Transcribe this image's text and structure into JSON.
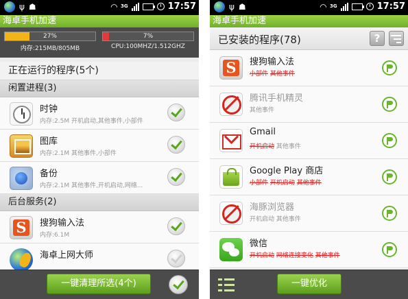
{
  "left": {
    "status_time": "17:57",
    "network_label": "3G",
    "app_title": "海卓手机加速",
    "memory": {
      "percent": 27,
      "percent_label": "27%",
      "label": "内存:215MB/805MB",
      "bar_color": "#f3b418"
    },
    "cpu": {
      "percent": 7,
      "percent_label": "7%",
      "label": "CPU:100MHZ/1.512GHZ",
      "bar_color": "#e03a3a"
    },
    "running_title": "正在运行的程序(5个)",
    "sections": [
      {
        "title": "闲置进程(3)",
        "items": [
          {
            "name": "时钟",
            "detail": "内存:2.5M 开机启动,其他事件,小部件",
            "icon": "clock-icon",
            "checked": true
          },
          {
            "name": "图库",
            "detail": "内存:2.1M 其他事件,小部件",
            "icon": "gallery-icon",
            "checked": true
          },
          {
            "name": "备份",
            "detail": "内存:2.1M 其他事件,开机启动,网络...",
            "icon": "backup-icon",
            "checked": true
          }
        ]
      },
      {
        "title": "后台服务(2)",
        "items": [
          {
            "name": "搜狗输入法",
            "detail": "内存:6.1M",
            "icon": "sogou-icon",
            "checked": true
          },
          {
            "name": "海卓上网大师",
            "detail": "",
            "icon": "globe-icon",
            "checked": false
          }
        ]
      }
    ],
    "clean_button": "一键清理所选(4个)"
  },
  "right": {
    "status_time": "17:57",
    "network_label": "3G",
    "app_title": "海卓手机加速",
    "installed_title": "已安装的程序(78)",
    "help_label": "?",
    "apps": [
      {
        "name": "搜狗输入法",
        "icon": "sogou-icon",
        "disabled": false,
        "tags": [
          {
            "text": "小部件",
            "style": "red"
          },
          {
            "text": "其他事件",
            "style": "red"
          }
        ]
      },
      {
        "name": "腾讯手机精灵",
        "icon": "blocked-app-icon",
        "disabled": true,
        "tags": [
          {
            "text": "其他事件",
            "style": "gray"
          }
        ]
      },
      {
        "name": "Gmail",
        "icon": "gmail-icon",
        "disabled": false,
        "tags": [
          {
            "text": "开机启动",
            "style": "red"
          },
          {
            "text": "其他事件",
            "style": "gray"
          }
        ]
      },
      {
        "name": "Google Play 商店",
        "icon": "google-play-icon",
        "disabled": false,
        "tags": [
          {
            "text": "小部件",
            "style": "red"
          },
          {
            "text": "开机启动",
            "style": "red"
          },
          {
            "text": "其他事件",
            "style": "red"
          }
        ]
      },
      {
        "name": "海豚浏览器",
        "icon": "blocked-app-icon",
        "disabled": true,
        "tags": [
          {
            "text": "开机启动",
            "style": "gray"
          },
          {
            "text": "其他事件",
            "style": "gray"
          }
        ]
      },
      {
        "name": "微信",
        "icon": "wechat-icon",
        "disabled": false,
        "tags": [
          {
            "text": "开机启动",
            "style": "red"
          },
          {
            "text": "网络连接变化",
            "style": "red"
          },
          {
            "text": "其他事件",
            "style": "red"
          }
        ]
      }
    ],
    "optimize_button": "一键优化"
  }
}
